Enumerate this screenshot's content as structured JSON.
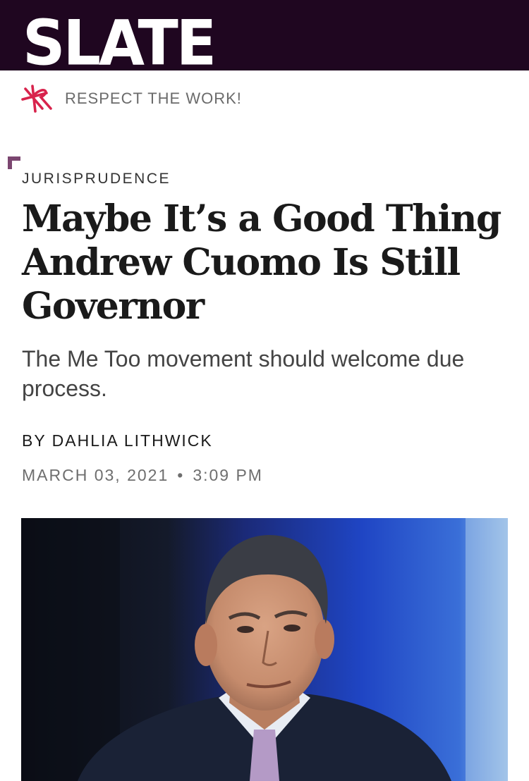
{
  "masthead": {
    "logo_text": "SLATE",
    "background_color": "#1f0620"
  },
  "promo": {
    "icon": "slate-plus-star-icon",
    "text": "RESPECT THE WORK!",
    "accent_color": "#d8234c"
  },
  "article": {
    "section": "JURISPRUDENCE",
    "headline": "Maybe It’s a Good Thing Andrew Cuomo Is Still Governor",
    "dek": "The Me Too movement should welcome due process.",
    "byline": "BY DAHLIA LITHWICK",
    "date": "MARCH 03, 2021",
    "separator": "•",
    "time": "3:09 PM"
  },
  "hero_image": {
    "icon": "article-photo"
  }
}
